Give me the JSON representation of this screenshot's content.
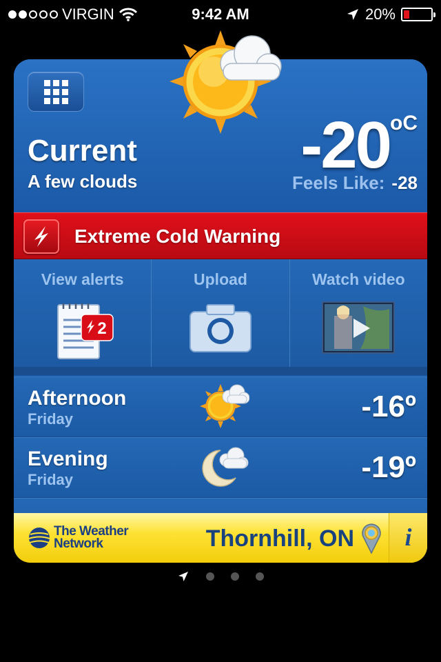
{
  "status_bar": {
    "carrier": "VIRGIN",
    "signal_bars_filled": 2,
    "signal_bars_total": 5,
    "time": "9:42 AM",
    "battery": "20%",
    "battery_level": 0.2,
    "battery_color": "#e0121c"
  },
  "current": {
    "title": "Current",
    "condition": "A few clouds",
    "temperature": "-20",
    "unit": "oC",
    "feels_like_label": "Feels Like:",
    "feels_like_value": "-28",
    "icon": "sun-with-cloud-icon"
  },
  "warning": {
    "text": "Extreme Cold Warning",
    "icon": "lightning-warning-icon",
    "color": "#d9101a"
  },
  "actions": [
    {
      "label": "View alerts",
      "icon": "alerts-notepad-icon",
      "badge": "2"
    },
    {
      "label": "Upload",
      "icon": "camera-icon"
    },
    {
      "label": "Watch video",
      "icon": "video-thumbnail-icon"
    }
  ],
  "forecast": [
    {
      "period": "Afternoon",
      "day": "Friday",
      "temp": "-16º",
      "icon": "sun-cloud-icon"
    },
    {
      "period": "Evening",
      "day": "Friday",
      "temp": "-19º",
      "icon": "moon-cloud-icon"
    }
  ],
  "footer": {
    "brand_line1": "The Weather",
    "brand_line2": "Network",
    "location": "Thornhill, ON",
    "info": "i"
  },
  "pager": {
    "pages": 3,
    "current_icon": "location-arrow-icon"
  },
  "colors": {
    "card_blue": "#1d63b4",
    "footer_yellow": "#fde234",
    "label_blue": "#9dc3ef"
  }
}
